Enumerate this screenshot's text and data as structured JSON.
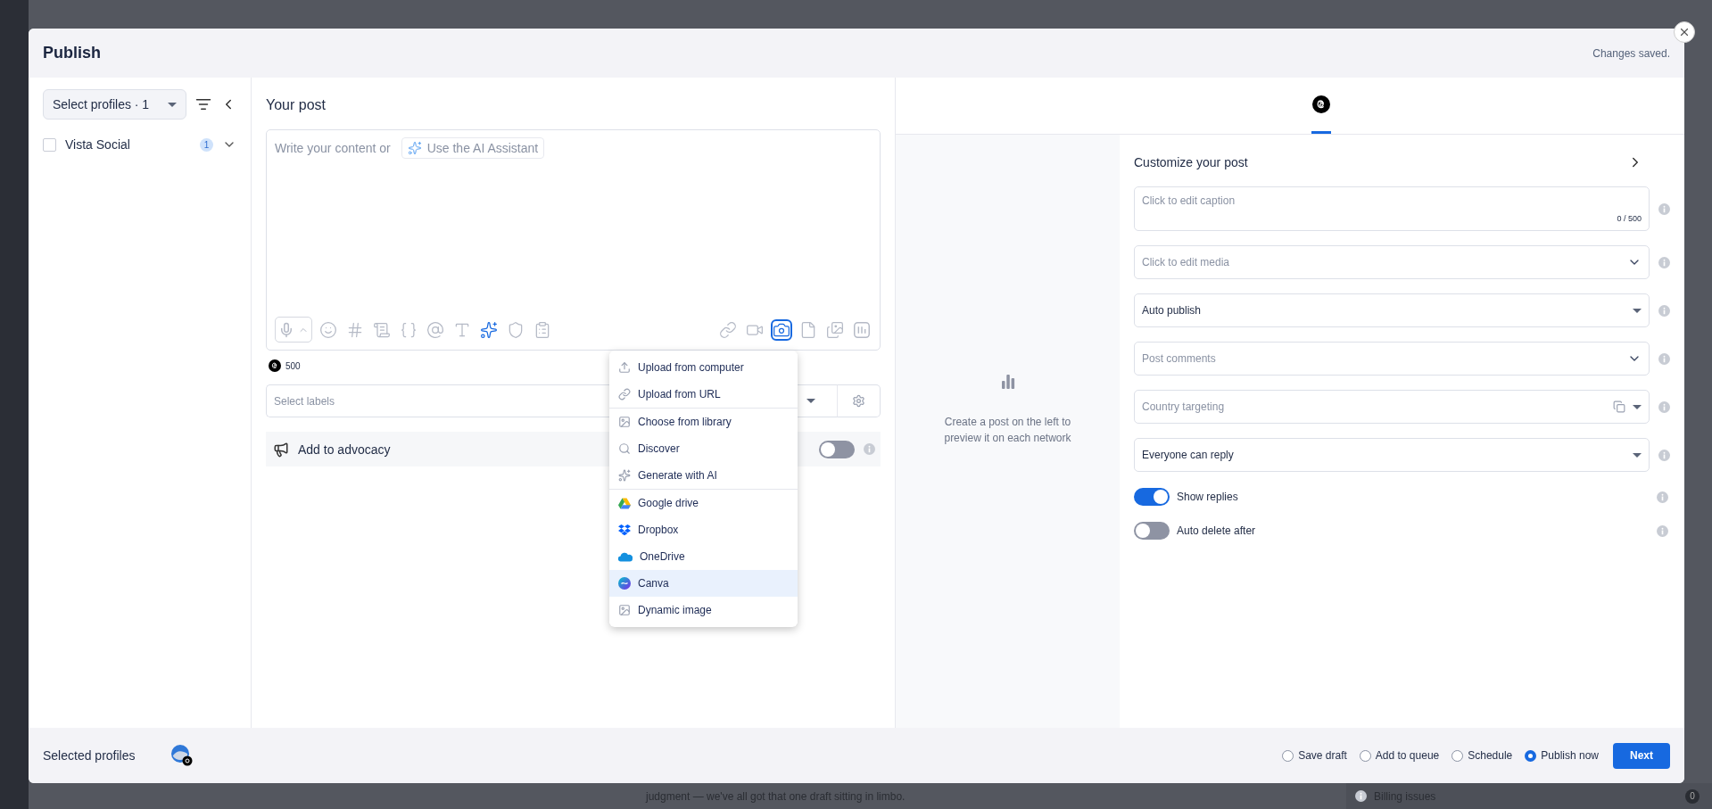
{
  "background": {
    "snippet": "judgment — we've all got that one draft sitting in limbo.",
    "billing": {
      "label": "Billing issues",
      "count": "0"
    }
  },
  "modal": {
    "title": "Publish",
    "status": "Changes saved."
  },
  "profiles": {
    "select": "Select profiles · 1",
    "items": [
      {
        "name": "Vista Social",
        "count": "1",
        "checked": false
      }
    ]
  },
  "editor": {
    "title": "Your post",
    "placeholder": "Write your content or",
    "ai_button": "Use the AI Assistant",
    "tools_left": [
      {
        "kind": "mic",
        "selected": false
      },
      {
        "kind": "emoji",
        "selected": false
      },
      {
        "kind": "hash",
        "selected": false
      },
      {
        "kind": "snippet",
        "selected": false
      },
      {
        "kind": "braces",
        "selected": false
      },
      {
        "kind": "mention",
        "selected": false
      },
      {
        "kind": "text",
        "selected": false
      },
      {
        "kind": "ai",
        "selected": false
      },
      {
        "kind": "shield",
        "selected": false
      },
      {
        "kind": "list",
        "selected": false
      }
    ],
    "tools_right": [
      {
        "kind": "link",
        "selected": false
      },
      {
        "kind": "video",
        "selected": false
      },
      {
        "kind": "camera",
        "selected": true
      },
      {
        "kind": "document",
        "selected": false
      },
      {
        "kind": "gallery",
        "selected": false
      },
      {
        "kind": "poll",
        "selected": false
      }
    ],
    "char_count": "500",
    "labels_placeholder": "Select labels",
    "advocacy": {
      "label": "Add to advocacy",
      "on": false
    }
  },
  "media_menu": {
    "sections": [
      [
        {
          "label": "Upload from computer",
          "kind": "upload",
          "selected": false
        },
        {
          "label": "Upload from URL",
          "kind": "link",
          "selected": false
        }
      ],
      [
        {
          "label": "Choose from library",
          "kind": "image",
          "selected": false
        },
        {
          "label": "Discover",
          "kind": "search",
          "selected": false
        },
        {
          "label": "Generate with AI",
          "kind": "sparkle",
          "selected": false
        }
      ],
      [
        {
          "label": "Google drive",
          "kind": "gdrive",
          "selected": false
        },
        {
          "label": "Dropbox",
          "kind": "dropbox",
          "selected": false
        },
        {
          "label": "OneDrive",
          "kind": "onedrive",
          "selected": false
        },
        {
          "label": "Canva",
          "kind": "canva",
          "selected": true
        },
        {
          "label": "Dynamic image",
          "kind": "image",
          "selected": false
        }
      ]
    ]
  },
  "preview": {
    "networks": [
      {
        "selected": true
      }
    ],
    "empty": "Create a post on the left to preview it on each network"
  },
  "customize": {
    "title": "Customize your post",
    "fields": [
      {
        "kind": "textarea",
        "placeholder": "Click to edit caption",
        "counter": "0 / 500"
      },
      {
        "kind": "chevron",
        "placeholder": "Click to edit media"
      },
      {
        "kind": "select",
        "value": "Auto publish"
      },
      {
        "kind": "chevron",
        "placeholder": "Post comments"
      },
      {
        "kind": "country",
        "placeholder": "Country targeting"
      },
      {
        "kind": "select",
        "value": "Everyone can reply"
      }
    ],
    "toggles": [
      {
        "label": "Show replies",
        "on": true
      },
      {
        "label": "Auto delete after",
        "on": false
      }
    ]
  },
  "footer": {
    "label": "Selected profiles",
    "options": [
      {
        "label": "Save draft",
        "selected": false
      },
      {
        "label": "Add to queue",
        "selected": false
      },
      {
        "label": "Schedule",
        "selected": false
      },
      {
        "label": "Publish now",
        "selected": true
      }
    ],
    "next": "Next"
  }
}
